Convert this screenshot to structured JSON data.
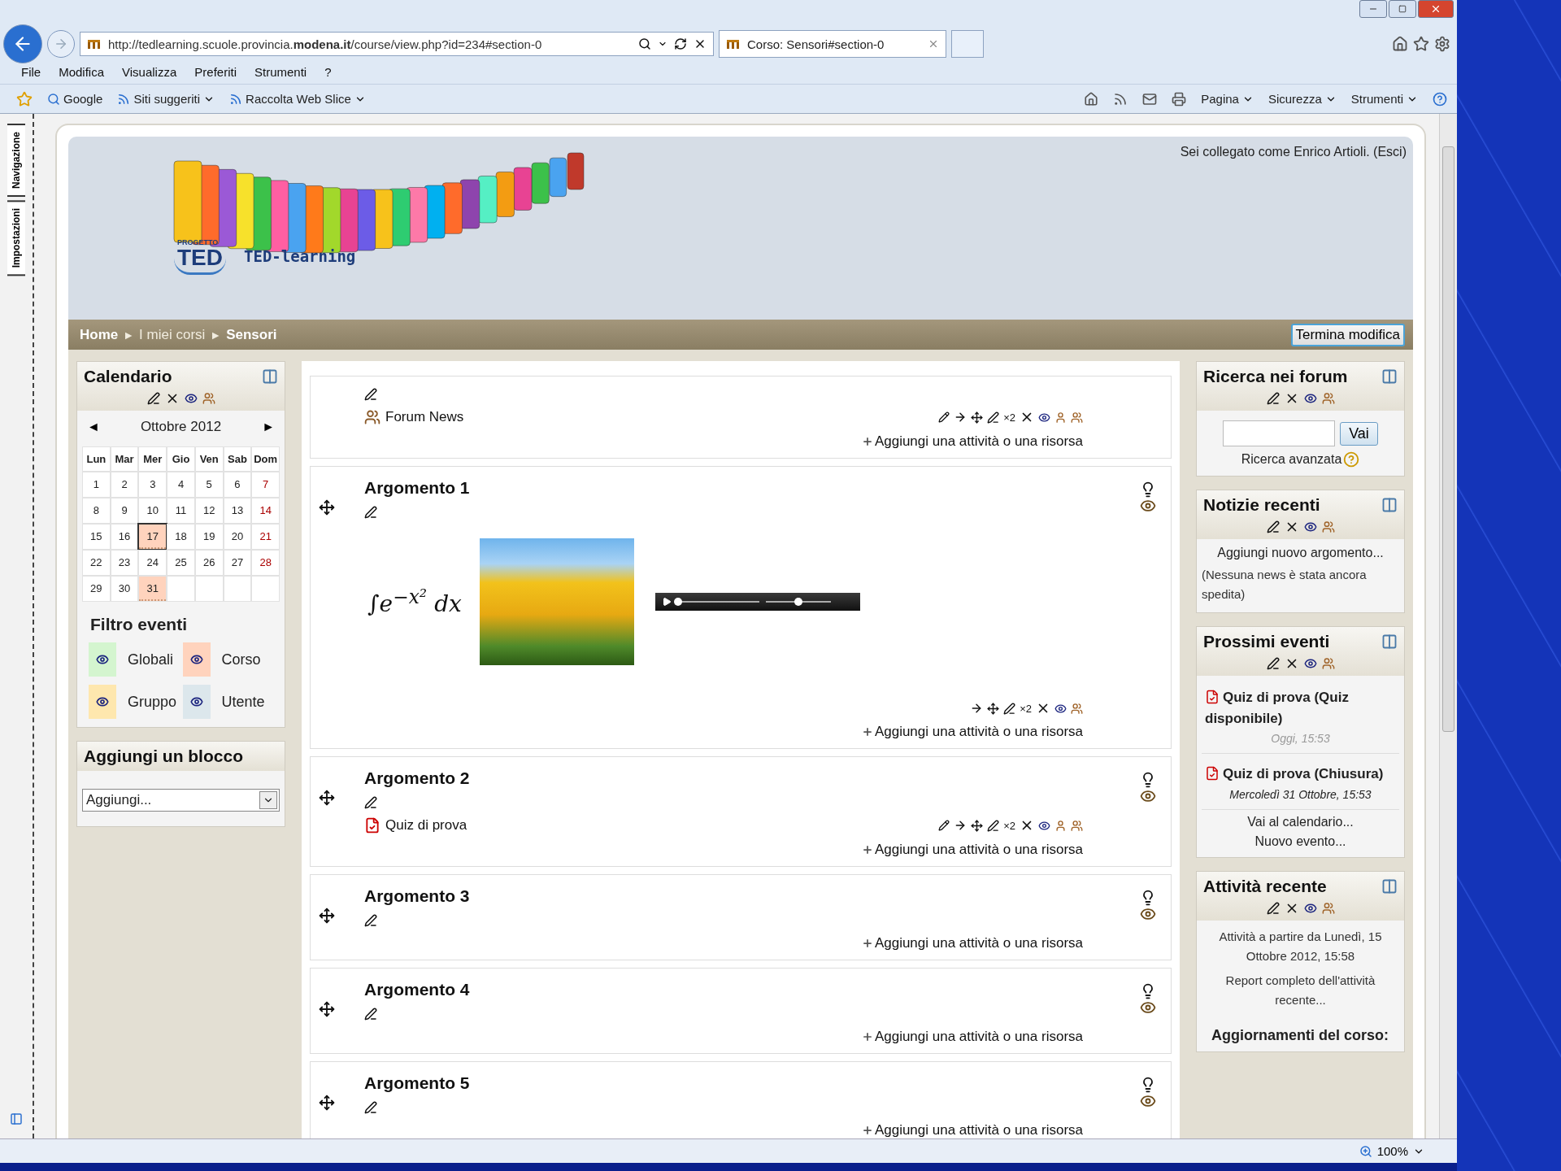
{
  "browser": {
    "url": "http://tedlearning.scuole.provincia.**modena.it**/course/view.php?id=234#section-0",
    "tab": "Corso: Sensori#section-0",
    "menu": [
      "File",
      "Modifica",
      "Visualizza",
      "Preferiti",
      "Strumenti",
      "?"
    ],
    "favorites": [
      {
        "label": "Google",
        "dropdown": false
      },
      {
        "label": "Siti suggeriti",
        "dropdown": true
      },
      {
        "label": "Raccolta Web Slice",
        "dropdown": true
      }
    ],
    "commands": [
      "Pagina",
      "Sicurezza",
      "Strumenti"
    ],
    "side_tabs": [
      "Navigazione",
      "Impostazioni"
    ],
    "zoom": "100%"
  },
  "header": {
    "logo": {
      "small": "PROGETTO",
      "big": "TED",
      "name": "TED-learning"
    },
    "login_text": "Sei collegato come Enrico Artioli.",
    "logout": "(Esci)"
  },
  "breadcrumb": {
    "separator": "►",
    "items": [
      {
        "label": "Home",
        "dimmed": false
      },
      {
        "label": "I miei corsi",
        "dimmed": true
      },
      {
        "label": "Sensori",
        "dimmed": false
      }
    ]
  },
  "edit_button": "Termina modifica",
  "calendar": {
    "title": "Calendario",
    "prev": "◄",
    "next": "►",
    "month": "Ottobre 2012",
    "weekdays": [
      "Lun",
      "Mar",
      "Mer",
      "Gio",
      "Ven",
      "Sab",
      "Dom"
    ],
    "weeks": [
      [
        {
          "day": "1",
          "today": false,
          "event": false
        },
        {
          "day": "2",
          "today": false,
          "event": false
        },
        {
          "day": "3",
          "today": false,
          "event": false
        },
        {
          "day": "4",
          "today": false,
          "event": false
        },
        {
          "day": "5",
          "today": false,
          "event": false
        },
        {
          "day": "6",
          "today": false,
          "event": false
        },
        {
          "day": "7",
          "today": false,
          "event": false
        }
      ],
      [
        {
          "day": "8",
          "today": false,
          "event": false
        },
        {
          "day": "9",
          "today": false,
          "event": false
        },
        {
          "day": "10",
          "today": false,
          "event": false
        },
        {
          "day": "11",
          "today": false,
          "event": false
        },
        {
          "day": "12",
          "today": false,
          "event": false
        },
        {
          "day": "13",
          "today": false,
          "event": false
        },
        {
          "day": "14",
          "today": false,
          "event": false
        }
      ],
      [
        {
          "day": "15",
          "today": false,
          "event": false
        },
        {
          "day": "16",
          "today": false,
          "event": false
        },
        {
          "day": "17",
          "today": true,
          "event": true
        },
        {
          "day": "18",
          "today": false,
          "event": false
        },
        {
          "day": "19",
          "today": false,
          "event": false
        },
        {
          "day": "20",
          "today": false,
          "event": false
        },
        {
          "day": "21",
          "today": false,
          "event": false
        }
      ],
      [
        {
          "day": "22",
          "today": false,
          "event": false
        },
        {
          "day": "23",
          "today": false,
          "event": false
        },
        {
          "day": "24",
          "today": false,
          "event": false
        },
        {
          "day": "25",
          "today": false,
          "event": false
        },
        {
          "day": "26",
          "today": false,
          "event": false
        },
        {
          "day": "27",
          "today": false,
          "event": false
        },
        {
          "day": "28",
          "today": false,
          "event": false
        }
      ],
      [
        {
          "day": "29",
          "today": false,
          "event": false
        },
        {
          "day": "30",
          "today": false,
          "event": false
        },
        {
          "day": "31",
          "today": false,
          "event": true
        }
      ]
    ],
    "filter_title": "Filtro eventi",
    "filters": [
      {
        "label": "Globali",
        "color": "#d4f5cf"
      },
      {
        "label": "Corso",
        "color": "#ffd3bd"
      },
      {
        "label": "Gruppo",
        "color": "#fee7ae"
      },
      {
        "label": "Utente",
        "color": "#dce7ec"
      }
    ]
  },
  "add_block": {
    "title": "Aggiungi un blocco",
    "select": "Aggiungi..."
  },
  "sections": [
    {
      "items": [
        {
          "kind": "forum",
          "label": "Forum News",
          "indent_mark": "×2"
        }
      ],
      "add_link": "Aggiungi una attività o una risorsa"
    },
    {
      "title": "Argomento 1",
      "items": [
        {
          "kind": "media",
          "formula": "∫e$^{−x²}$ dx",
          "indent_mark": "×2",
          "player": {
            "position": {
              "level": 0.0
            },
            "volume": {
              "level": 0.5
            }
          }
        }
      ],
      "add_link": "Aggiungi una attività o una risorsa"
    },
    {
      "title": "Argomento 2",
      "items": [
        {
          "kind": "quiz",
          "label": "Quiz di prova",
          "indent_mark": "×2"
        }
      ],
      "add_link": "Aggiungi una attività o una risorsa"
    },
    {
      "title": "Argomento 3",
      "add_link": "Aggiungi una attività o una risorsa"
    },
    {
      "title": "Argomento 4",
      "add_link": "Aggiungi una attività o una risorsa"
    },
    {
      "title": "Argomento 5",
      "add_link": "Aggiungi una attività o una risorsa"
    }
  ],
  "search_block": {
    "title": "Ricerca nei forum",
    "button": "Vai",
    "advanced": "Ricerca avanzata"
  },
  "news_block": {
    "title": "Notizie recenti",
    "add": "Aggiungi nuovo argomento...",
    "empty": "(Nessuna news è stata ancora spedita)"
  },
  "events_block": {
    "title": "Prossimi eventi",
    "events": [
      {
        "name": "Quiz di prova (Quiz disponibile)",
        "date": "Oggi, 15:53",
        "today": true
      },
      {
        "name": "Quiz di prova (Chiusura)",
        "date": "Mercoledì 31 Ottobre, 15:53",
        "today": false
      }
    ],
    "links": [
      "Vai al calendario...",
      "Nuovo evento..."
    ]
  },
  "activity_block": {
    "title": "Attività recente",
    "since": "Attività a partire da Lunedì, 15 Ottobre 2012, 15:58",
    "report": "Report completo dell'attività recente...",
    "updates": "Aggiornamenti del corso:"
  }
}
